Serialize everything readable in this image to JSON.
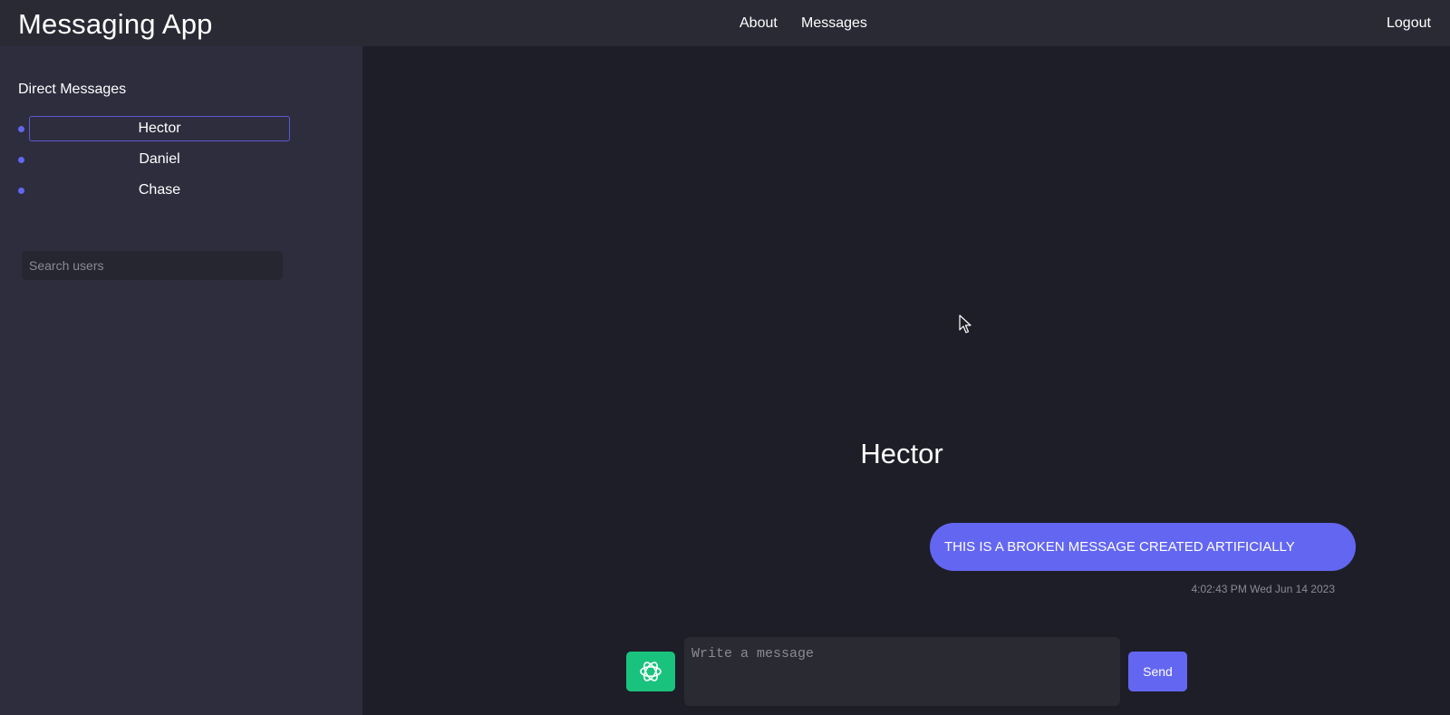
{
  "header": {
    "brand": "Messaging App",
    "nav": {
      "about": "About",
      "messages": "Messages",
      "logout": "Logout"
    }
  },
  "sidebar": {
    "title": "Direct Messages",
    "users": [
      {
        "name": "Hector",
        "active": true
      },
      {
        "name": "Daniel",
        "active": false
      },
      {
        "name": "Chase",
        "active": false
      }
    ],
    "search_placeholder": "Search users"
  },
  "chat": {
    "title": "Hector",
    "messages": [
      {
        "text": "THIS IS A BROKEN MESSAGE CREATED ARTIFICIALLY",
        "timestamp": "4:02:43 PM Wed Jun 14 2023"
      }
    ],
    "input_placeholder": "Write a message",
    "send_label": "Send",
    "assistant_icon": "openai-icon"
  },
  "colors": {
    "accent": "#6366f1",
    "assistant": "#19c37d",
    "sidebar_bg": "#2e2d3d",
    "main_bg": "#1e1e28",
    "topbar_bg": "#2a2a35"
  }
}
